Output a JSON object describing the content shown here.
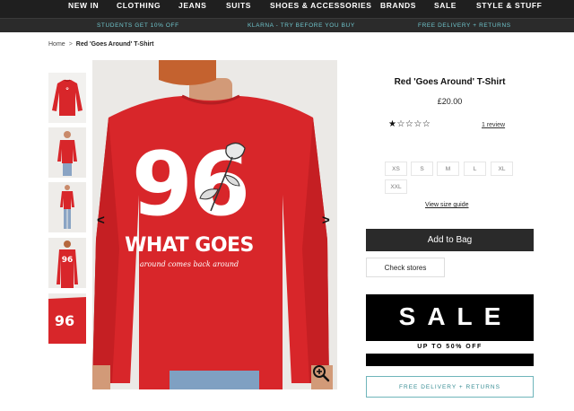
{
  "nav": {
    "items": [
      "NEW IN",
      "CLOTHING",
      "JEANS",
      "SUITS",
      "SHOES & ACCESSORIES",
      "BRANDS",
      "SALE",
      "STYLE & STUFF"
    ]
  },
  "promo": {
    "items": [
      "STUDENTS GET 10% OFF",
      "KLARNA - TRY BEFORE YOU BUY",
      "FREE DELIVERY + RETURNS"
    ]
  },
  "breadcrumb": {
    "home": "Home",
    "separator": ">",
    "current": "Red 'Goes Around' T-Shirt"
  },
  "gallery": {
    "print_number": "96",
    "print_text": "WHAT GOES",
    "print_script": "around comes back around",
    "prev_arrow": "<",
    "next_arrow": ">",
    "zoom_icon": "zoom-in-icon"
  },
  "product": {
    "title": "Red 'Goes Around' T-Shirt",
    "price": "£20.00",
    "rating": 1,
    "rating_max": 5,
    "stars": "★☆☆☆☆",
    "review_link": "1 review",
    "sizes": [
      "XS",
      "S",
      "M",
      "L",
      "XL",
      "XXL"
    ],
    "size_guide": "View size guide",
    "add_to_bag": "Add to Bag",
    "check_stores": "Check stores"
  },
  "sale_banner": {
    "headline": "SALE",
    "subline": "UP TO 50% OFF"
  },
  "delivery_banner": {
    "label": "FREE DELIVERY + RETURNS"
  },
  "colors": {
    "nav_bg": "#1f1f1f",
    "promo_text": "#6fc5cc",
    "shirt_red": "#d8262a",
    "button_dark": "#2a2a2a",
    "delivery_border": "#6fb5bb"
  }
}
